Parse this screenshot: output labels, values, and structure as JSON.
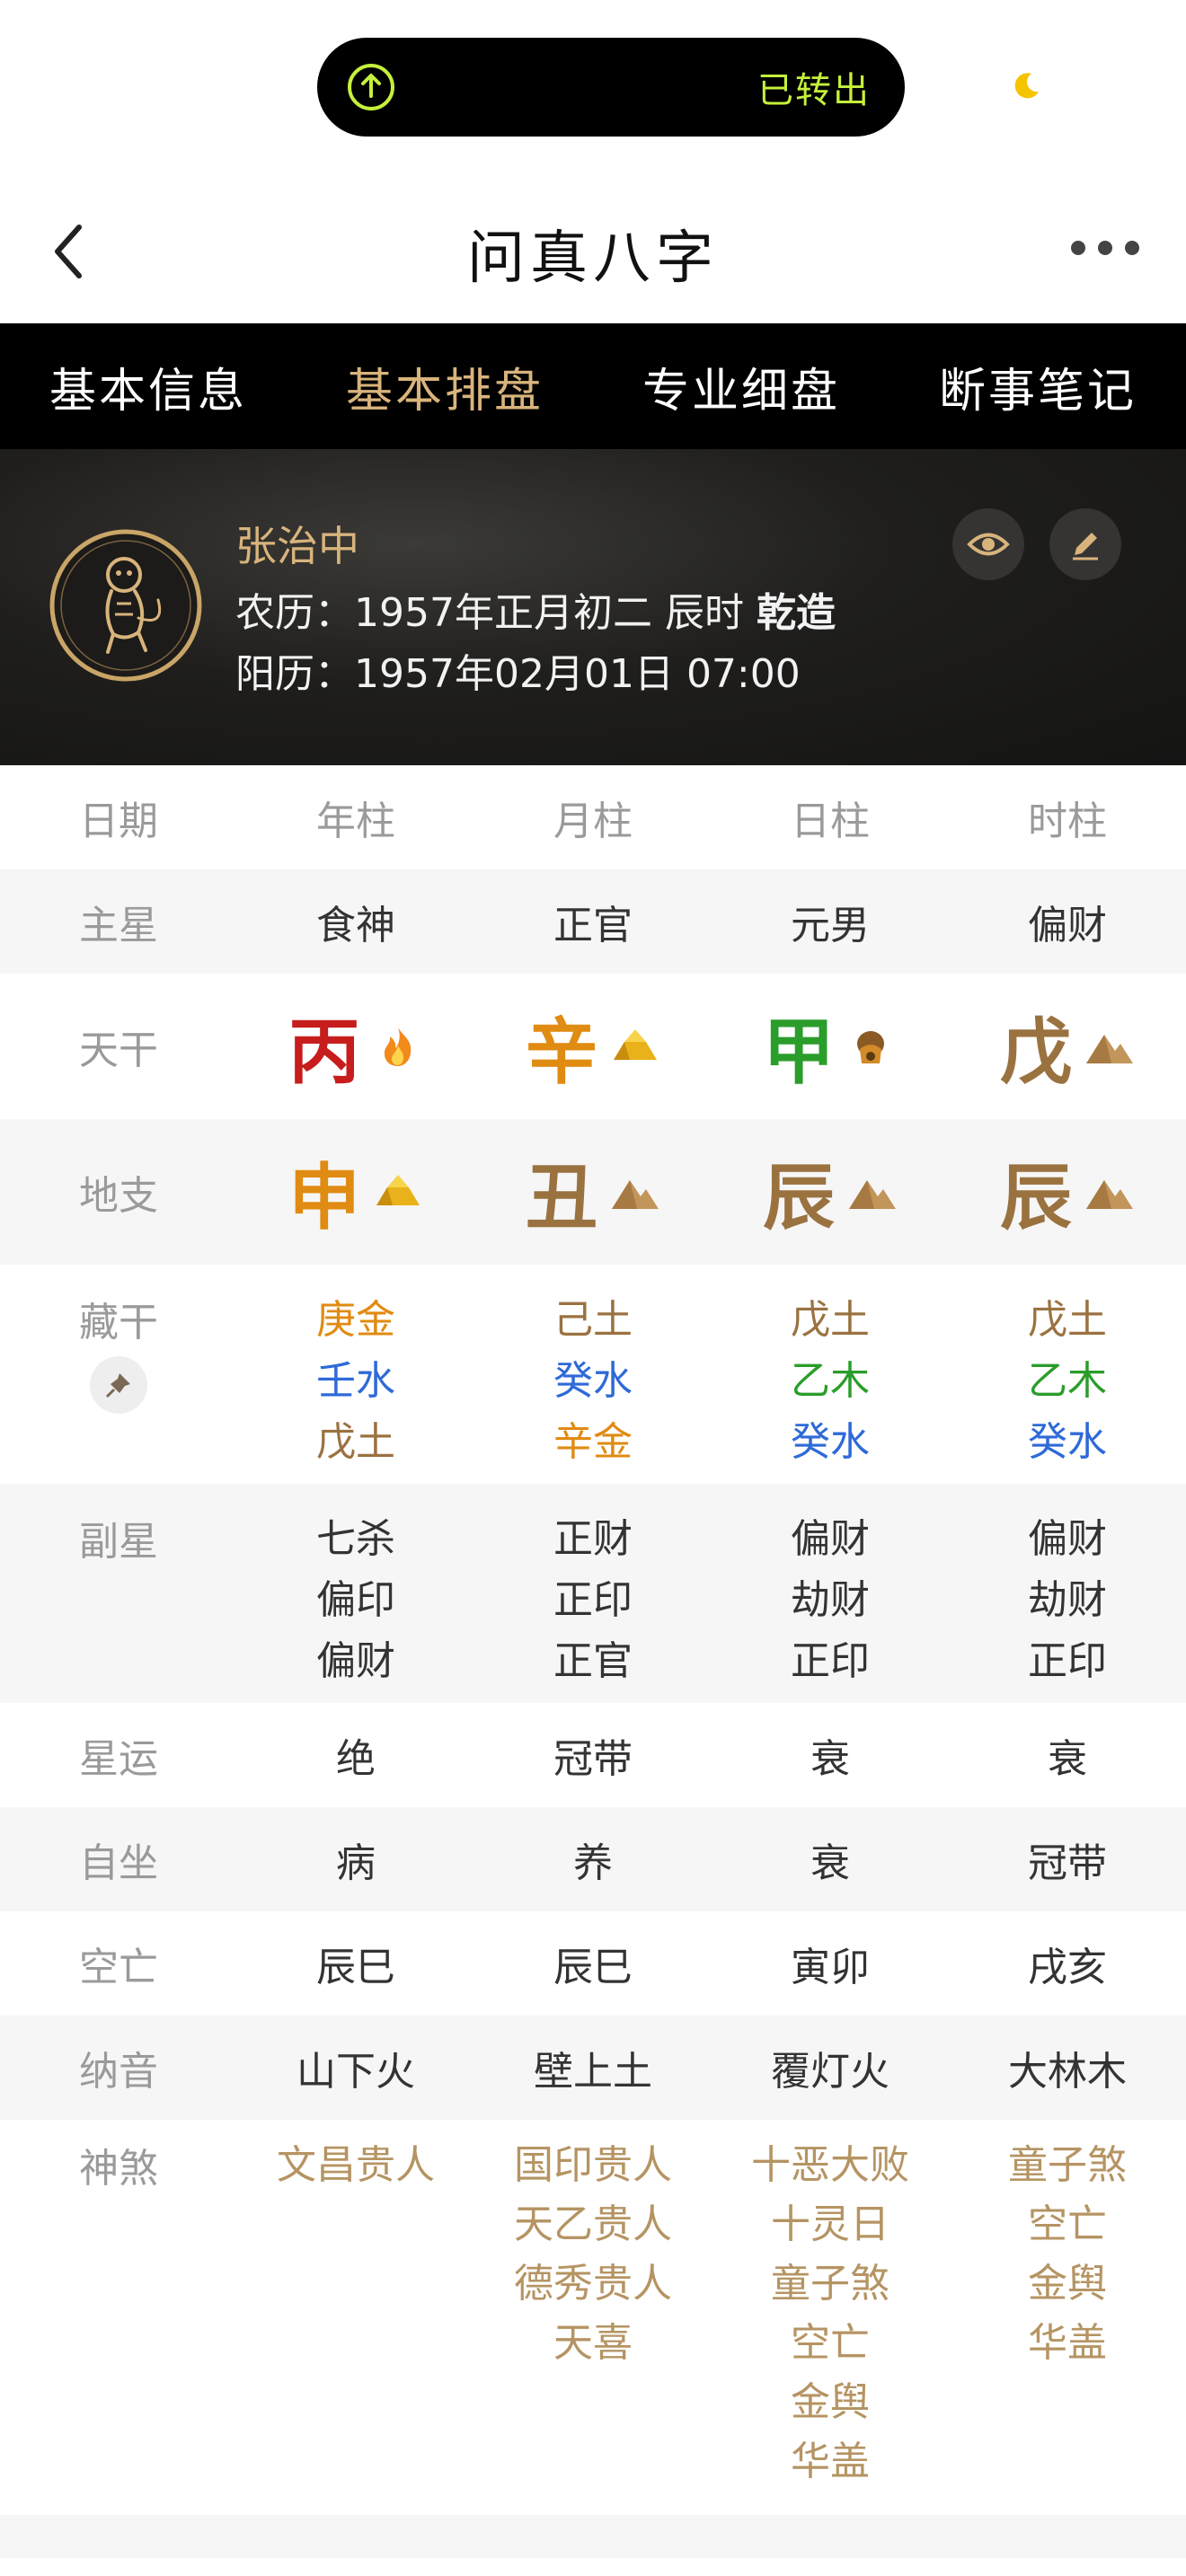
{
  "status": {
    "pill_text": "已转出"
  },
  "nav": {
    "title": "问真八字"
  },
  "tabs": [
    "基本信息",
    "基本排盘",
    "专业细盘",
    "断事笔记"
  ],
  "profile": {
    "name": "张治中",
    "lunar_label": "农历：1957年正月初二 辰时 ",
    "gender_tag": "乾造",
    "solar_label": "阳历：1957年02月01日 07:00"
  },
  "table": {
    "header": [
      "日期",
      "年柱",
      "月柱",
      "日柱",
      "时柱"
    ],
    "zhuxing": {
      "label": "主星",
      "values": [
        "食神",
        "正官",
        "元男",
        "偏财"
      ]
    },
    "tiangan": {
      "label": "天干",
      "values": [
        {
          "char": "丙",
          "color": "#c81d1d",
          "icon": "fire-icon"
        },
        {
          "char": "辛",
          "color": "#e08b12",
          "icon": "gold-ingot-icon"
        },
        {
          "char": "甲",
          "color": "#2a9d2a",
          "icon": "wood-icon"
        },
        {
          "char": "戊",
          "color": "#9a7240",
          "icon": "earth-mound-icon"
        }
      ]
    },
    "dizhi": {
      "label": "地支",
      "values": [
        {
          "char": "申",
          "color": "#e08b12",
          "icon": "gold-ingot-icon"
        },
        {
          "char": "丑",
          "color": "#9a7240",
          "icon": "earth-mound-icon"
        },
        {
          "char": "辰",
          "color": "#9a7240",
          "icon": "earth-mound-icon"
        },
        {
          "char": "辰",
          "color": "#9a7240",
          "icon": "earth-mound-icon"
        }
      ]
    },
    "canggan": {
      "label": "藏干",
      "values": [
        [
          {
            "t": "庚金",
            "c": "#e08b12"
          },
          {
            "t": "壬水",
            "c": "#2e6ad8"
          },
          {
            "t": "戊土",
            "c": "#9a7240"
          }
        ],
        [
          {
            "t": "己土",
            "c": "#9a7240"
          },
          {
            "t": "癸水",
            "c": "#2e6ad8"
          },
          {
            "t": "辛金",
            "c": "#e08b12"
          }
        ],
        [
          {
            "t": "戊土",
            "c": "#9a7240"
          },
          {
            "t": "乙木",
            "c": "#2a9d2a"
          },
          {
            "t": "癸水",
            "c": "#2e6ad8"
          }
        ],
        [
          {
            "t": "戊土",
            "c": "#9a7240"
          },
          {
            "t": "乙木",
            "c": "#2a9d2a"
          },
          {
            "t": "癸水",
            "c": "#2e6ad8"
          }
        ]
      ]
    },
    "fuxing": {
      "label": "副星",
      "values": [
        [
          "七杀",
          "偏印",
          "偏财"
        ],
        [
          "正财",
          "正印",
          "正官"
        ],
        [
          "偏财",
          "劫财",
          "正印"
        ],
        [
          "偏财",
          "劫财",
          "正印"
        ]
      ]
    },
    "xingyun": {
      "label": "星运",
      "values": [
        "绝",
        "冠带",
        "衰",
        "衰"
      ]
    },
    "zizuo": {
      "label": "自坐",
      "values": [
        "病",
        "养",
        "衰",
        "冠带"
      ]
    },
    "kongwang": {
      "label": "空亡",
      "values": [
        "辰巳",
        "辰巳",
        "寅卯",
        "戌亥"
      ]
    },
    "nayin": {
      "label": "纳音",
      "values": [
        "山下火",
        "壁上土",
        "覆灯火",
        "大林木"
      ]
    },
    "shensha": {
      "label": "神煞",
      "values": [
        [
          "文昌贵人"
        ],
        [
          "国印贵人",
          "天乙贵人",
          "德秀贵人",
          "天喜"
        ],
        [
          "十恶大败",
          "十灵日",
          "童子煞",
          "空亡",
          "金舆",
          "华盖"
        ],
        [
          "童子煞",
          "空亡",
          "金舆",
          "华盖"
        ]
      ]
    }
  },
  "colors": {
    "accent_gold": "#d8b47c",
    "shensha_gold": "#b59463",
    "label_gray": "#9a9a9a"
  }
}
